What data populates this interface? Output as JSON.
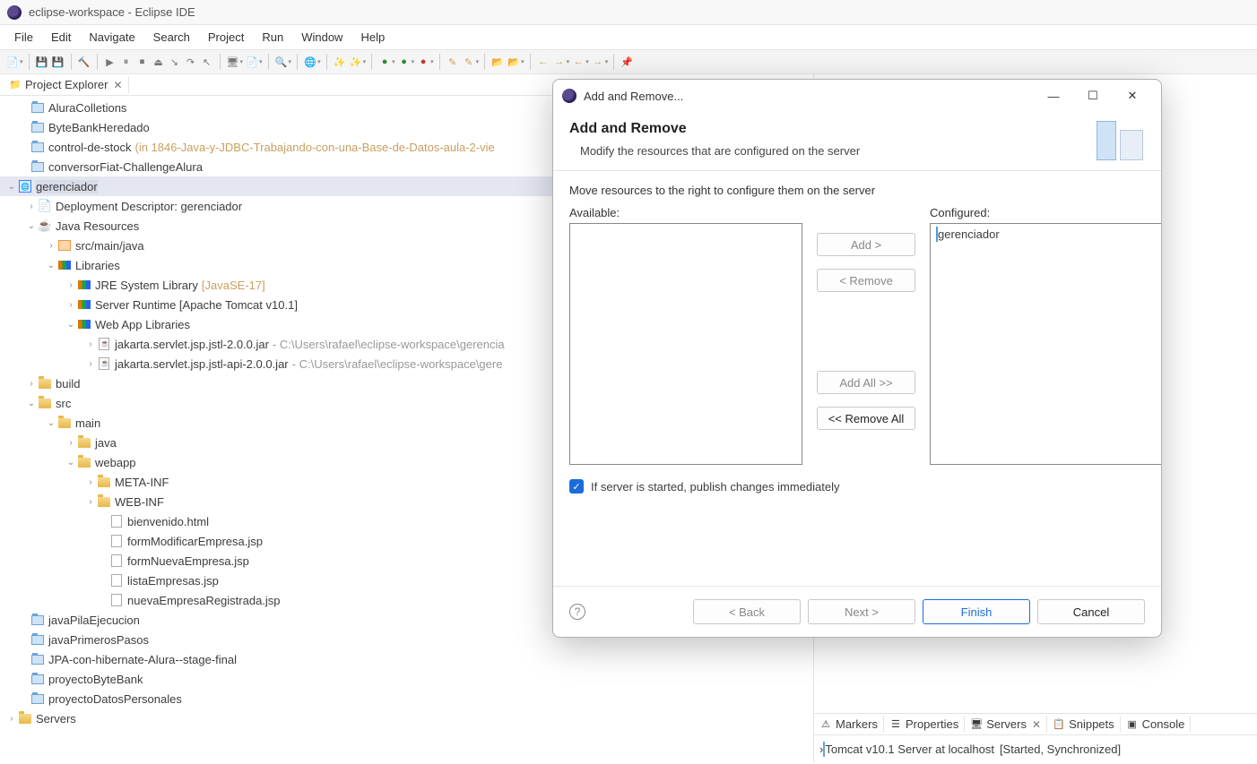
{
  "window": {
    "title": "eclipse-workspace - Eclipse IDE"
  },
  "menu": {
    "file": "File",
    "edit": "Edit",
    "navigate": "Navigate",
    "search": "Search",
    "project": "Project",
    "run": "Run",
    "window": "Window",
    "help": "Help"
  },
  "explorer": {
    "tab": "Project Explorer",
    "items": {
      "aluracolletions": "AluraColletions",
      "bytebank": "ByteBankHeredado",
      "control": "control-de-stock",
      "control_hint": "(in 1846-Java-y-JDBC-Trabajando-con-una-Base-de-Datos-aula-2-vie",
      "conversor": "conversorFiat-ChallengeAlura",
      "gerenciador": "gerenciador",
      "depdesc": "Deployment Descriptor: gerenciador",
      "javares": "Java Resources",
      "srcmain": "src/main/java",
      "libraries": "Libraries",
      "jre": "JRE System Library",
      "jre_hint": "[JavaSE-17]",
      "serverrt": "Server Runtime [Apache Tomcat v10.1]",
      "webapplib": "Web App Libraries",
      "jstl1": "jakarta.servlet.jsp.jstl-2.0.0.jar",
      "jstl1_hint": "- C:\\Users\\rafael\\eclipse-workspace\\gerencia",
      "jstl2": "jakarta.servlet.jsp.jstl-api-2.0.0.jar",
      "jstl2_hint": "- C:\\Users\\rafael\\eclipse-workspace\\gere",
      "build": "build",
      "src": "src",
      "main": "main",
      "java": "java",
      "webapp": "webapp",
      "metainf": "META-INF",
      "webinf": "WEB-INF",
      "bienvenido": "bienvenido.html",
      "formmod": "formModificarEmpresa.jsp",
      "formnueva": "formNuevaEmpresa.jsp",
      "lista": "listaEmpresas.jsp",
      "nuevareg": "nuevaEmpresaRegistrada.jsp",
      "javapila": "javaPilaEjecucion",
      "javaprim": "javaPrimerosPasos",
      "jpahib": "JPA-con-hibernate-Alura--stage-final",
      "proyectobb": "proyectoByteBank",
      "proyectodp": "proyectoDatosPersonales",
      "servers": "Servers"
    }
  },
  "bottom": {
    "markers": "Markers",
    "properties": "Properties",
    "servers": "Servers",
    "snippets": "Snippets",
    "console": "Console",
    "server_name": "Tomcat v10.1 Server at localhost",
    "server_state": "[Started, Synchronized]"
  },
  "dialog": {
    "title": "Add and Remove...",
    "heading": "Add and Remove",
    "sub": "Modify the resources that are configured on the server",
    "move_hint": "Move resources to the right to configure them on the server",
    "available_label": "Available:",
    "configured_label": "Configured:",
    "configured_item": "gerenciador",
    "add": "Add >",
    "remove": "< Remove",
    "addall": "Add All >>",
    "removeall": "<< Remove All",
    "publish_chk": "If server is started, publish changes immediately",
    "back": "< Back",
    "next": "Next >",
    "finish": "Finish",
    "cancel": "Cancel"
  }
}
